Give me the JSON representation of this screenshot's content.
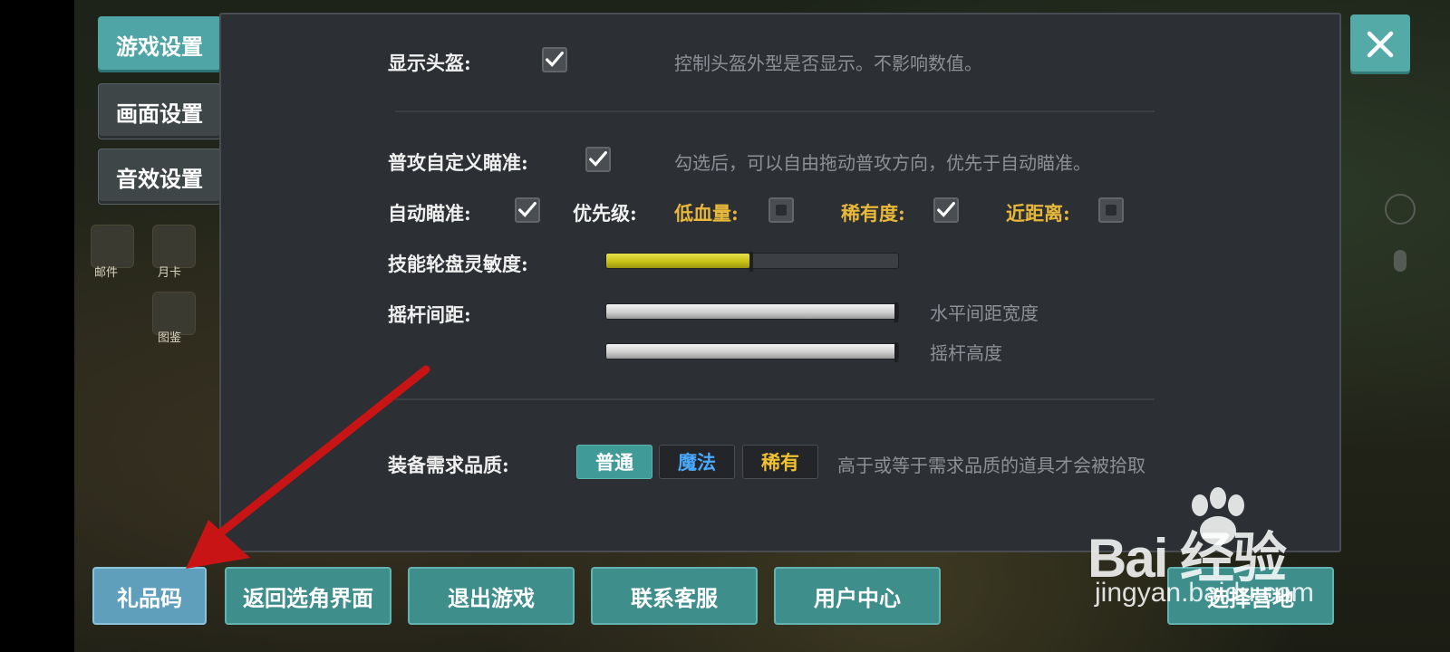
{
  "tabs": [
    {
      "label": "游戏设置",
      "active": true
    },
    {
      "label": "画面设置",
      "active": false
    },
    {
      "label": "音效设置",
      "active": false
    }
  ],
  "background": {
    "labels": [
      "邮件",
      "月卡",
      "图鉴"
    ]
  },
  "settings": {
    "show_helmet": {
      "label": "显示头盔:",
      "checked": true,
      "desc": "控制头盔外型是否显示。不影响数值。"
    },
    "custom_aim": {
      "label": "普攻自定义瞄准:",
      "checked": true,
      "desc": "勾选后，可以自由拖动普攻方向，优先于自动瞄准。"
    },
    "auto_aim": {
      "label": "自动瞄准:",
      "checked": true,
      "priority_label": "优先级:",
      "options": [
        {
          "label": "低血量:",
          "checked": false
        },
        {
          "label": "稀有度:",
          "checked": true
        },
        {
          "label": "近距离:",
          "checked": false
        }
      ]
    },
    "skill_sensitivity": {
      "label": "技能轮盘灵敏度:",
      "value": 0.49
    },
    "joystick": {
      "label": "摇杆间距:",
      "horizontal": {
        "value": 1.0,
        "desc": "水平间距宽度"
      },
      "height": {
        "value": 1.0,
        "desc": "摇杆高度"
      }
    },
    "quality": {
      "label": "装备需求品质:",
      "options": [
        {
          "label": "普通",
          "color": "#ffffff",
          "selected": true
        },
        {
          "label": "魔法",
          "color": "#4aa8ff",
          "selected": false
        },
        {
          "label": "稀有",
          "color": "#f0c030",
          "selected": false
        }
      ],
      "desc": "高于或等于需求品质的道具才会被拾取"
    }
  },
  "close": {
    "icon": "close-icon"
  },
  "bottom_buttons": [
    "礼品码",
    "返回选角界面",
    "退出游戏",
    "联系客服",
    "用户中心",
    "选择营地"
  ],
  "watermark": {
    "brand": "Bai 经验",
    "url": "jingyan.baidu.com"
  },
  "colors": {
    "accent": "#4fa5a5",
    "arrow": "#c81414",
    "slider_yellow": "#d6d020"
  }
}
